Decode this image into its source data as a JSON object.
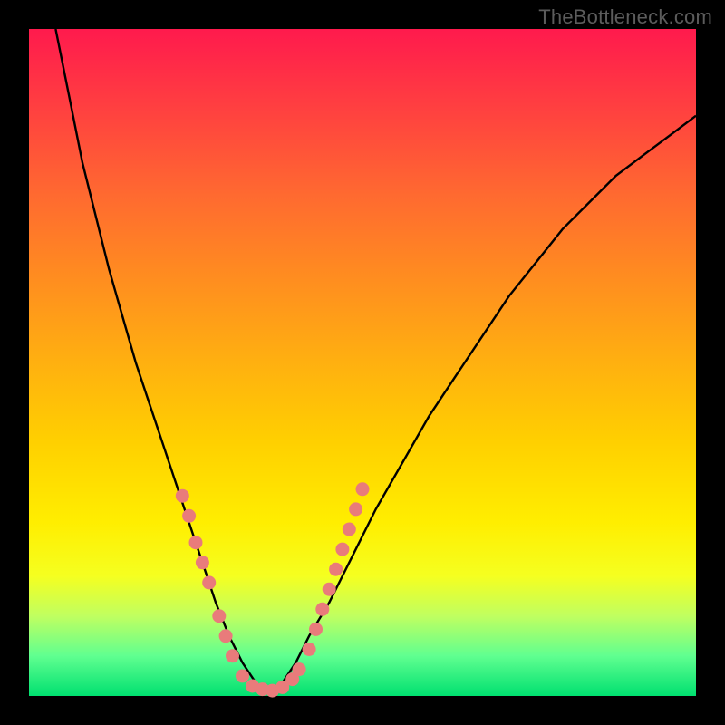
{
  "watermark": "TheBottleneck.com",
  "chart_data": {
    "type": "line",
    "title": "",
    "xlabel": "",
    "ylabel": "",
    "xlim": [
      0,
      100
    ],
    "ylim": [
      0,
      100
    ],
    "series": [
      {
        "name": "bottleneck-curve",
        "x": [
          4,
          6,
          8,
          10,
          12,
          14,
          16,
          18,
          20,
          22,
          24,
          26,
          28,
          30,
          32,
          34,
          36,
          38,
          40,
          42,
          45,
          48,
          52,
          56,
          60,
          64,
          68,
          72,
          76,
          80,
          84,
          88,
          92,
          96,
          100
        ],
        "y": [
          100,
          90,
          80,
          72,
          64,
          57,
          50,
          44,
          38,
          32,
          26,
          20,
          14,
          9,
          5,
          2,
          0.5,
          2,
          5,
          9,
          14,
          20,
          28,
          35,
          42,
          48,
          54,
          60,
          65,
          70,
          74,
          78,
          81,
          84,
          87
        ]
      }
    ],
    "markers": {
      "name": "pink-dots",
      "color": "#e97b7b",
      "points": [
        {
          "x": 23,
          "y": 30
        },
        {
          "x": 24,
          "y": 27
        },
        {
          "x": 25,
          "y": 23
        },
        {
          "x": 26,
          "y": 20
        },
        {
          "x": 27,
          "y": 17
        },
        {
          "x": 28.5,
          "y": 12
        },
        {
          "x": 29.5,
          "y": 9
        },
        {
          "x": 30.5,
          "y": 6
        },
        {
          "x": 32,
          "y": 3
        },
        {
          "x": 33.5,
          "y": 1.5
        },
        {
          "x": 35,
          "y": 1
        },
        {
          "x": 36.5,
          "y": 0.8
        },
        {
          "x": 38,
          "y": 1.3
        },
        {
          "x": 39.5,
          "y": 2.5
        },
        {
          "x": 40.5,
          "y": 4
        },
        {
          "x": 42,
          "y": 7
        },
        {
          "x": 43,
          "y": 10
        },
        {
          "x": 44,
          "y": 13
        },
        {
          "x": 45,
          "y": 16
        },
        {
          "x": 46,
          "y": 19
        },
        {
          "x": 47,
          "y": 22
        },
        {
          "x": 48,
          "y": 25
        },
        {
          "x": 49,
          "y": 28
        },
        {
          "x": 50,
          "y": 31
        }
      ]
    },
    "background_gradient": {
      "top": "#ff1a4d",
      "middle": "#ffd000",
      "bottom": "#00e070"
    }
  }
}
